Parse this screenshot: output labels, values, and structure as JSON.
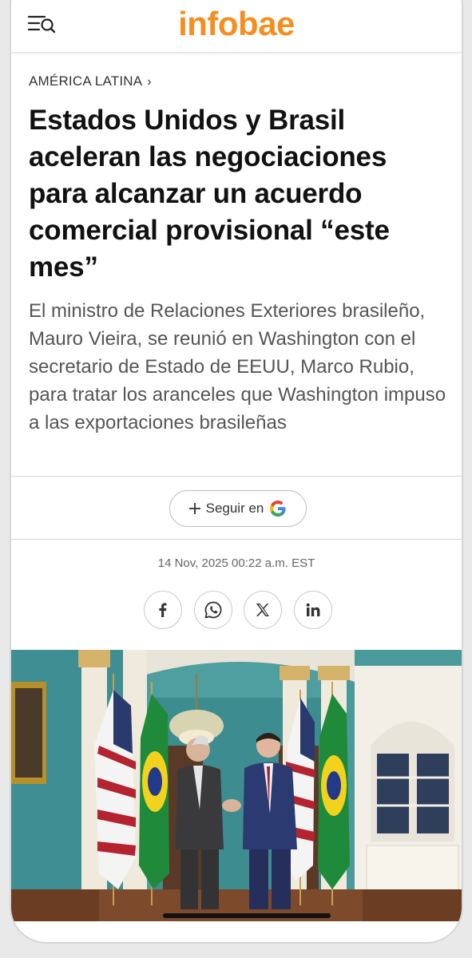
{
  "header": {
    "logo_text": "infobae",
    "menu_icon": "menu-search-icon",
    "brand_color": "#f68e1f"
  },
  "article": {
    "section": "AMÉRICA LATINA",
    "section_chevron": "›",
    "headline": "Estados Unidos y Brasil aceleran las negociaciones para alcanzar un acuerdo comercial provisional “este mes”",
    "subheadline": "El ministro de Relaciones Exteriores brasileño, Mauro Vieira, se reunió en Washington con el secretario de Estado de EEUU, Marco Rubio, para tratar los aranceles que Washington impuso a las exportaciones brasileñas",
    "follow_label": "Seguir en",
    "follow_icons": [
      "plus-icon",
      "google-icon"
    ],
    "date": "14 Nov, 2025 00:22 a.m. EST",
    "share_icons": [
      "facebook-icon",
      "whatsapp-icon",
      "x-icon",
      "linkedin-icon"
    ],
    "photo": "photo-two-men-shaking-hands-between-flags"
  }
}
